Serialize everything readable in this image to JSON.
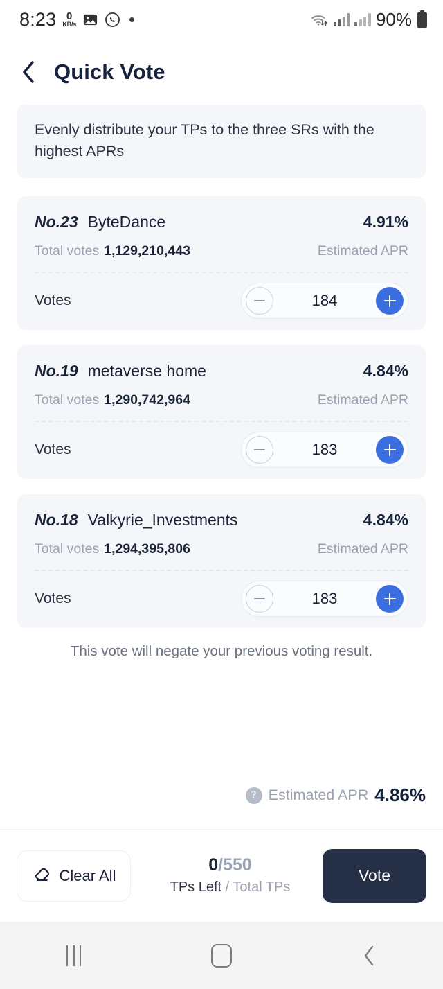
{
  "status_bar": {
    "time": "8:23",
    "net_speed_value": "0",
    "net_speed_unit": "KB/s",
    "icons": [
      "image-icon",
      "whatsapp-icon",
      "dot-indicator"
    ],
    "wifi": "wifi-icon",
    "signal_1": "signal-bars-icon",
    "signal_2": "signal-bars-icon",
    "battery_percent": "90%",
    "battery": "battery-icon"
  },
  "header": {
    "back": "back-chevron-icon",
    "title": "Quick Vote"
  },
  "banner": {
    "text": "Evenly distribute your TPs to the three SRs with the highest APRs"
  },
  "cards": [
    {
      "rank": "No.23",
      "name": "ByteDance",
      "apr": "4.91%",
      "total_votes_label": "Total votes",
      "total_votes": "1,129,210,443",
      "apr_label": "Estimated APR",
      "votes_label": "Votes",
      "votes": "184",
      "minus": "minus-icon",
      "plus": "plus-icon"
    },
    {
      "rank": "No.19",
      "name": "metaverse home",
      "apr": "4.84%",
      "total_votes_label": "Total votes",
      "total_votes": "1,290,742,964",
      "apr_label": "Estimated APR",
      "votes_label": "Votes",
      "votes": "183",
      "minus": "minus-icon",
      "plus": "plus-icon"
    },
    {
      "rank": "No.18",
      "name": "Valkyrie_Investments",
      "apr": "4.84%",
      "total_votes_label": "Total votes",
      "total_votes": "1,294,395,806",
      "apr_label": "Estimated APR",
      "votes_label": "Votes",
      "votes": "183",
      "minus": "minus-icon",
      "plus": "plus-icon"
    }
  ],
  "note": "This vote will negate your previous voting result.",
  "apr_summary": {
    "help": "?",
    "label": "Estimated APR",
    "value": "4.86%"
  },
  "bottom_bar": {
    "clear_all_label": "Clear All",
    "clear_all_icon": "eraser-icon",
    "tps_left": "0",
    "tps_total": "/550",
    "tps_caption_left": "TPs Left ",
    "tps_caption_right": "/ Total TPs",
    "vote_label": "Vote"
  },
  "nav_bar": {
    "recents": "recents-icon",
    "home": "home-icon",
    "back": "back-icon"
  },
  "colors": {
    "accent_blue": "#3b6fe0",
    "dark_navy": "#252f45",
    "card_bg": "#f4f6f9",
    "muted_text": "#9aa2b1"
  }
}
